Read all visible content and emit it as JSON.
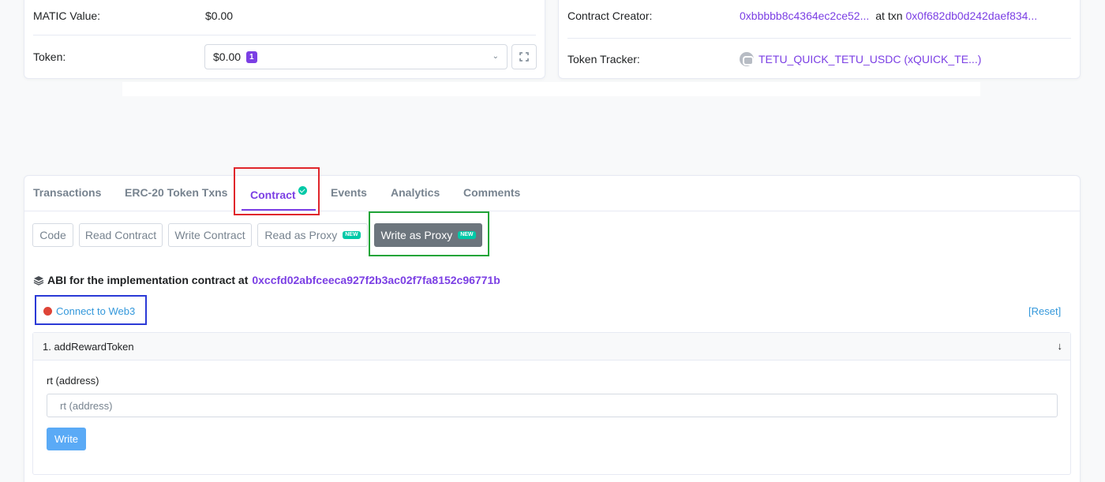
{
  "overview": {
    "matic_label": "MATIC Value:",
    "matic_value": "$0.00",
    "token_label": "Token:",
    "token_value": "$0.00",
    "token_count": "1"
  },
  "more_info": {
    "creator_label": "Contract Creator:",
    "creator_address": "0xbbbbb8c4364ec2ce52...",
    "at_txn": "at txn",
    "txn_hash": "0x0f682db0d242daef834...",
    "tracker_label": "Token Tracker:",
    "tracker_name": "TETU_QUICK_TETU_USDC (xQUICK_TE...)"
  },
  "tabs": [
    {
      "label": "Transactions"
    },
    {
      "label": "ERC-20 Token Txns"
    },
    {
      "label": "Contract",
      "active": true,
      "verified_icon": "check-circle-icon"
    },
    {
      "label": "Events"
    },
    {
      "label": "Analytics"
    },
    {
      "label": "Comments"
    }
  ],
  "subtabs": [
    {
      "label": "Code"
    },
    {
      "label": "Read Contract"
    },
    {
      "label": "Write Contract"
    },
    {
      "label": "Read as Proxy",
      "badge": "NEW"
    },
    {
      "label": "Write as Proxy",
      "badge": "NEW",
      "active": true
    }
  ],
  "abi": {
    "text": "ABI for the implementation contract at",
    "address": "0xccfd02abfceeca927f2b3ac02f7fa8152c96771b"
  },
  "connect": {
    "label": "Connect to Web3",
    "status_color": "#de4437"
  },
  "reset_label": "[Reset]",
  "function": {
    "title": "1. addRewardToken",
    "param_label": "rt (address)",
    "param_placeholder": "rt (address)",
    "write_label": "Write"
  },
  "colors": {
    "accent": "#7b3fe4",
    "link_blue": "#3498db",
    "verified": "#00c9a7",
    "highlight_red": "#e0262b",
    "highlight_green": "#22a538",
    "highlight_blue": "#2b3ad6"
  }
}
